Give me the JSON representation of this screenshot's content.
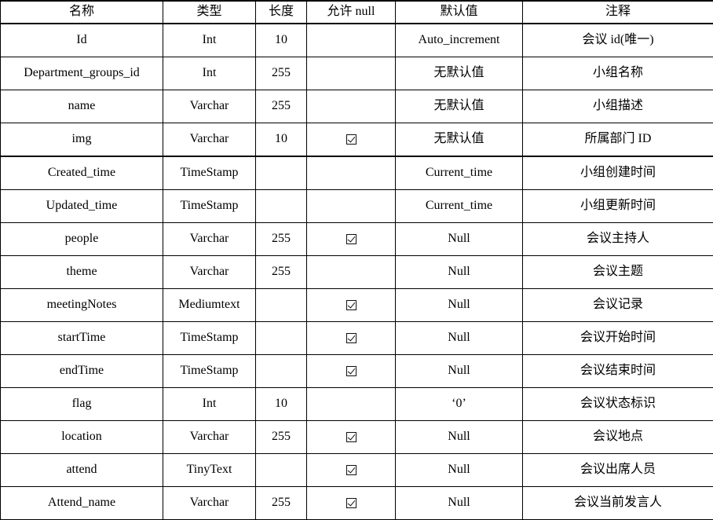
{
  "table": {
    "columns": [
      {
        "key": "name",
        "label": "名称"
      },
      {
        "key": "type",
        "label": "类型"
      },
      {
        "key": "length",
        "label": "长度"
      },
      {
        "key": "nullable",
        "label": "允许 null"
      },
      {
        "key": "default",
        "label": "默认值"
      },
      {
        "key": "comment",
        "label": "注释"
      }
    ],
    "rows": [
      {
        "name": "Id",
        "type": "Int",
        "length": "10",
        "nullable": false,
        "default": "Auto_increment",
        "comment": "会议 id(唯一)",
        "block_end": false
      },
      {
        "name": "Department_groups_id",
        "type": "Int",
        "length": "255",
        "nullable": false,
        "default": "无默认值",
        "comment": "小组名称",
        "block_end": false
      },
      {
        "name": "name",
        "type": "Varchar",
        "length": "255",
        "nullable": false,
        "default": "无默认值",
        "comment": "小组描述",
        "block_end": false
      },
      {
        "name": "img",
        "type": "Varchar",
        "length": "10",
        "nullable": true,
        "default": "无默认值",
        "comment": "所属部门 ID",
        "block_end": true
      },
      {
        "name": "Created_time",
        "type": "TimeStamp",
        "length": "",
        "nullable": false,
        "default": "Current_time",
        "comment": "小组创建时间",
        "block_end": false
      },
      {
        "name": "Updated_time",
        "type": "TimeStamp",
        "length": "",
        "nullable": false,
        "default": "Current_time",
        "comment": "小组更新时间",
        "block_end": false
      },
      {
        "name": "people",
        "type": "Varchar",
        "length": "255",
        "nullable": true,
        "default": "Null",
        "comment": "会议主持人",
        "block_end": false
      },
      {
        "name": "theme",
        "type": "Varchar",
        "length": "255",
        "nullable": false,
        "default": "Null",
        "comment": "会议主题",
        "block_end": false
      },
      {
        "name": "meetingNotes",
        "type": "Mediumtext",
        "length": "",
        "nullable": true,
        "default": "Null",
        "comment": "会议记录",
        "block_end": false
      },
      {
        "name": "startTime",
        "type": "TimeStamp",
        "length": "",
        "nullable": true,
        "default": "Null",
        "comment": "会议开始时间",
        "block_end": false
      },
      {
        "name": "endTime",
        "type": "TimeStamp",
        "length": "",
        "nullable": true,
        "default": "Null",
        "comment": "会议结束时间",
        "block_end": false
      },
      {
        "name": "flag",
        "type": "Int",
        "length": "10",
        "nullable": false,
        "default": "‘0’",
        "comment": "会议状态标识",
        "block_end": false
      },
      {
        "name": "location",
        "type": "Varchar",
        "length": "255",
        "nullable": true,
        "default": "Null",
        "comment": "会议地点",
        "block_end": false
      },
      {
        "name": "attend",
        "type": "TinyText",
        "length": "",
        "nullable": true,
        "default": "Null",
        "comment": "会议出席人员",
        "block_end": false
      },
      {
        "name": "Attend_name",
        "type": "Varchar",
        "length": "255",
        "nullable": true,
        "default": "Null",
        "comment": "会议当前发言人",
        "block_end": false
      }
    ]
  }
}
